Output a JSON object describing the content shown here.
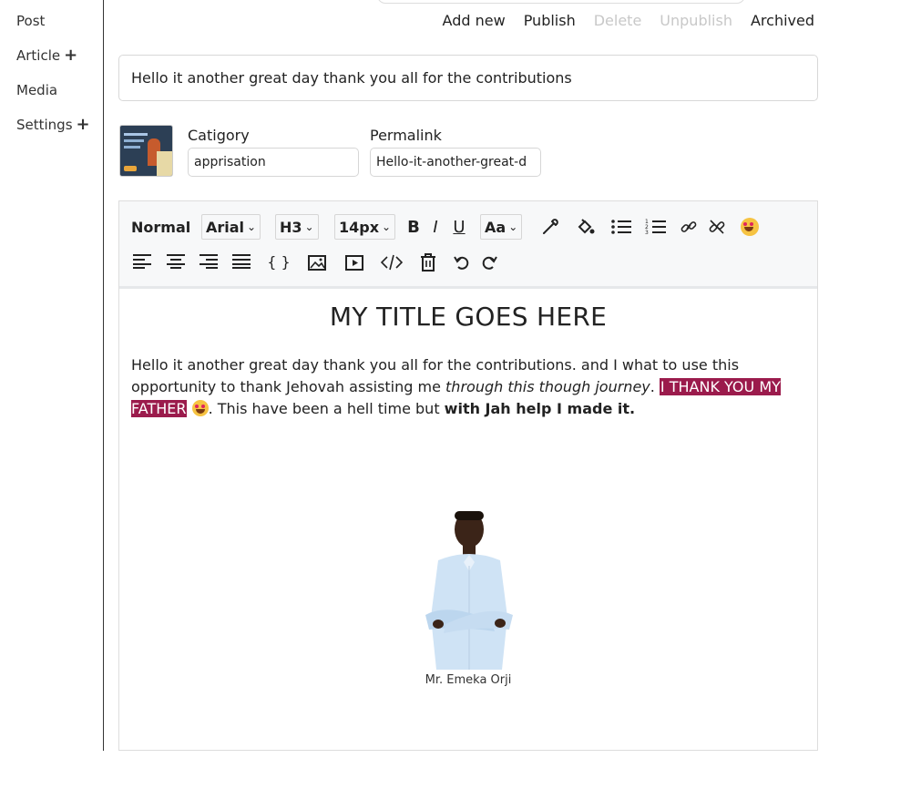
{
  "sidebar": {
    "items": [
      {
        "label": "Post",
        "has_plus": false
      },
      {
        "label": "Article",
        "has_plus": true
      },
      {
        "label": "Media",
        "has_plus": false
      },
      {
        "label": "Settings",
        "has_plus": true
      }
    ]
  },
  "actions": {
    "add_new": "Add new",
    "publish": "Publish",
    "delete": "Delete",
    "unpublish": "Unpublish",
    "archived": "Archived"
  },
  "post": {
    "title_value": "Hello it another great day thank you all for the contributions",
    "category_label": "Catigory",
    "category_value": "apprisation",
    "permalink_label": "Permalink",
    "permalink_value": "Hello-it-another-great-d"
  },
  "toolbar": {
    "block_style": "Normal",
    "font_family": "Arial",
    "heading": "H3",
    "font_size": "14px",
    "bold": "B",
    "italic": "I",
    "underline": "U",
    "text_case": "Aa",
    "code_block": "{ }"
  },
  "document": {
    "title": "MY TITLE GOES HERE",
    "para_part1": "Hello it another great day thank you all for the contributions. and I what to use this opportunity to thank Jehovah assisting me ",
    "para_italic": "through this though journey",
    "para_part2": ". ",
    "para_highlight": "I THANK YOU MY FATHER",
    "para_part3": ".  This have been a hell time but ",
    "para_bold": "with Jah help  I made it.",
    "image_caption": "Mr. Emeka Orji"
  },
  "colors": {
    "highlight": "#9b1b4c",
    "toolbar_bg": "#f7f8f9",
    "disabled_text": "#c8c8c8"
  }
}
